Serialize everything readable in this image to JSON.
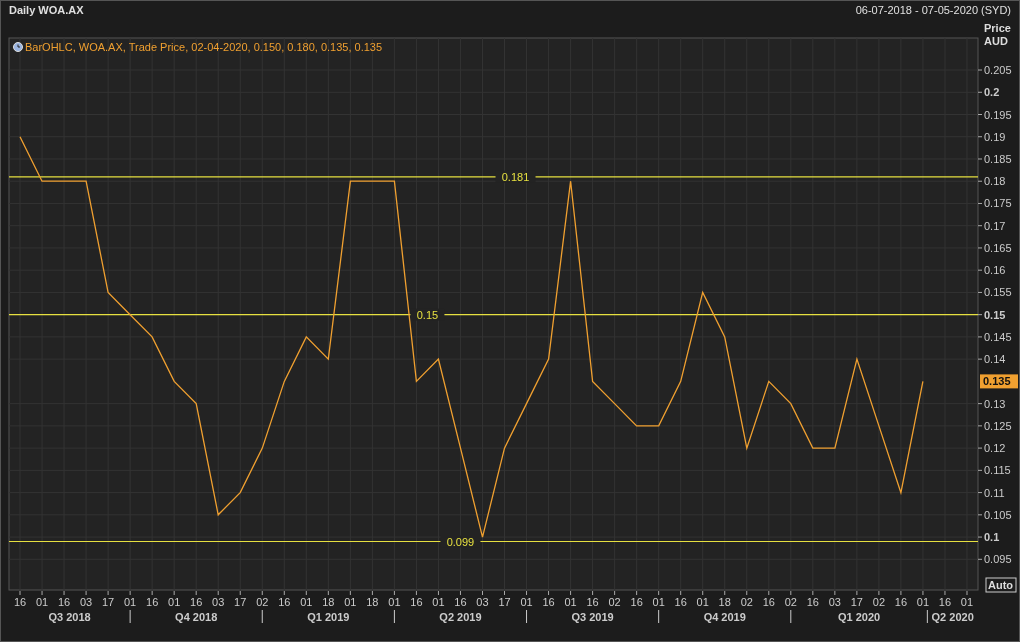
{
  "header": {
    "title": "Daily WOA.AX",
    "date_range": "06-07-2018 - 07-05-2020 (SYD)"
  },
  "legend": "BarOHLC, WOA.AX, Trade Price, 02-04-2020, 0.150, 0.180, 0.135, 0.135",
  "axis": {
    "title": "Price",
    "unit": "AUD",
    "last_price": "0.135",
    "auto_button": "Auto"
  },
  "quarters": [
    "Q3 2018",
    "Q4 2018",
    "Q1 2019",
    "Q2 2019",
    "Q3 2019",
    "Q4 2019",
    "Q1 2020",
    "Q2 2020"
  ],
  "chart_data": {
    "type": "line",
    "ylim": [
      0.0881,
      0.2122
    ],
    "categories": [
      "16",
      "01",
      "16",
      "03",
      "17",
      "01",
      "16",
      "01",
      "16",
      "03",
      "17",
      "02",
      "16",
      "01",
      "18",
      "01",
      "18",
      "01",
      "16",
      "01",
      "16",
      "03",
      "17",
      "01",
      "16",
      "01",
      "16",
      "02",
      "16",
      "01",
      "16",
      "01",
      "18",
      "02",
      "16",
      "02",
      "16",
      "03",
      "17",
      "02",
      "16",
      "01",
      "16",
      "01"
    ],
    "series": [
      {
        "color": "#f0a030",
        "values": [
          0.19,
          0.18,
          0.18,
          0.18,
          0.155,
          0.15,
          0.145,
          0.135,
          0.13,
          0.105,
          0.11,
          0.12,
          0.135,
          0.145,
          0.14,
          0.18,
          0.18,
          0.18,
          0.135,
          0.14,
          0.12,
          0.1,
          0.12,
          0.13,
          0.14,
          0.18,
          0.135,
          0.13,
          0.125,
          0.125,
          0.135,
          0.155,
          0.145,
          0.12,
          0.135,
          0.13,
          0.12,
          0.12,
          0.14,
          0.125,
          0.11,
          0.135,
          null,
          null
        ]
      }
    ],
    "yticks": [
      {
        "value": 0.205,
        "label": "0.205"
      },
      {
        "value": 0.2,
        "label": "0.2"
      },
      {
        "value": 0.195,
        "label": "0.195"
      },
      {
        "value": 0.19,
        "label": "0.19"
      },
      {
        "value": 0.185,
        "label": "0.185"
      },
      {
        "value": 0.18,
        "label": "0.18"
      },
      {
        "value": 0.175,
        "label": "0.175"
      },
      {
        "value": 0.17,
        "label": "0.17"
      },
      {
        "value": 0.165,
        "label": "0.165"
      },
      {
        "value": 0.16,
        "label": "0.16"
      },
      {
        "value": 0.155,
        "label": "0.155"
      },
      {
        "value": 0.15,
        "label": "0.15"
      },
      {
        "value": 0.145,
        "label": "0.145"
      },
      {
        "value": 0.14,
        "label": "0.14"
      },
      {
        "value": 0.13,
        "label": "0.13"
      },
      {
        "value": 0.125,
        "label": "0.125"
      },
      {
        "value": 0.12,
        "label": "0.12"
      },
      {
        "value": 0.115,
        "label": "0.115"
      },
      {
        "value": 0.11,
        "label": "0.11"
      },
      {
        "value": 0.105,
        "label": "0.105"
      },
      {
        "value": 0.1,
        "label": "0.1"
      },
      {
        "value": 0.095,
        "label": "0.095"
      }
    ],
    "grid": true,
    "ref_lines": [
      {
        "axis": "y",
        "value": 0.181,
        "label": "0.181",
        "color": "#e6e040"
      },
      {
        "axis": "y",
        "value": 0.15,
        "label": "0.15",
        "color": "#e6e040"
      },
      {
        "axis": "y",
        "value": 0.099,
        "label": "0.099",
        "color": "#e6e040"
      }
    ]
  }
}
